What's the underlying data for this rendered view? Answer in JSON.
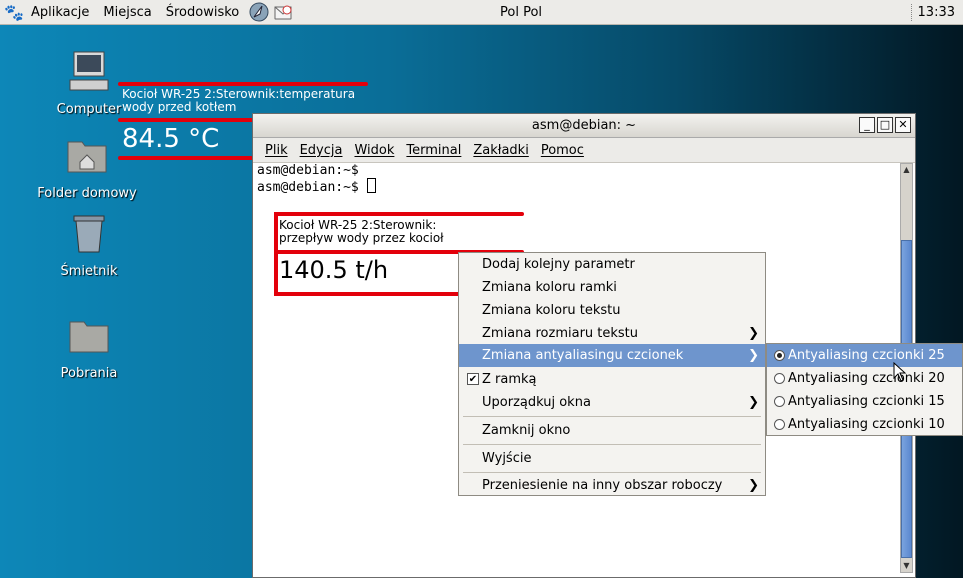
{
  "panel": {
    "menus": [
      "Aplikacje",
      "Miejsca",
      "Środowisko"
    ],
    "center": "Pol Pol",
    "clock": "13:33"
  },
  "desktop": [
    {
      "label": "Computer",
      "icon": "computer-icon"
    },
    {
      "label": "Folder domowy",
      "icon": "home-folder-icon"
    },
    {
      "label": "Śmietnik",
      "icon": "trash-icon"
    },
    {
      "label": "Pobrania",
      "icon": "folder-icon"
    }
  ],
  "widget1": {
    "title_line1": "Kocioł WR-25 2:Sterownik:temperatura",
    "title_line2": "wody przed kotłem",
    "value": "84.5 °C"
  },
  "widget2": {
    "title_line1": "Kocioł WR-25 2:Sterownik:",
    "title_line2": "przepływ wody przez kocioł",
    "value": "140.5 t/h"
  },
  "terminal": {
    "title": "asm@debian: ~",
    "menus": [
      "Plik",
      "Edycja",
      "Widok",
      "Terminal",
      "Zakładki",
      "Pomoc"
    ],
    "lines": [
      "asm@debian:~$",
      "asm@debian:~$ "
    ]
  },
  "context_menu": {
    "items": [
      "Dodaj kolejny parametr",
      "Zmiana koloru ramki",
      "Zmiana koloru tekstu",
      "Zmiana rozmiaru tekstu",
      "Zmiana antyaliasingu czcionek",
      "Z ramką",
      "Uporządkuj okna",
      "Zamknij okno",
      "Wyjście",
      "Przeniesienie na inny obszar roboczy"
    ]
  },
  "submenu": {
    "items": [
      "Antyaliasing czcionki 25",
      "Antyaliasing czcionki 20",
      "Antyaliasing czcionki 15",
      "Antyaliasing czcionki 10"
    ],
    "selected_index": 0
  },
  "colors": {
    "accent": "#6e95cd",
    "widget_frame": "#e3000b"
  }
}
